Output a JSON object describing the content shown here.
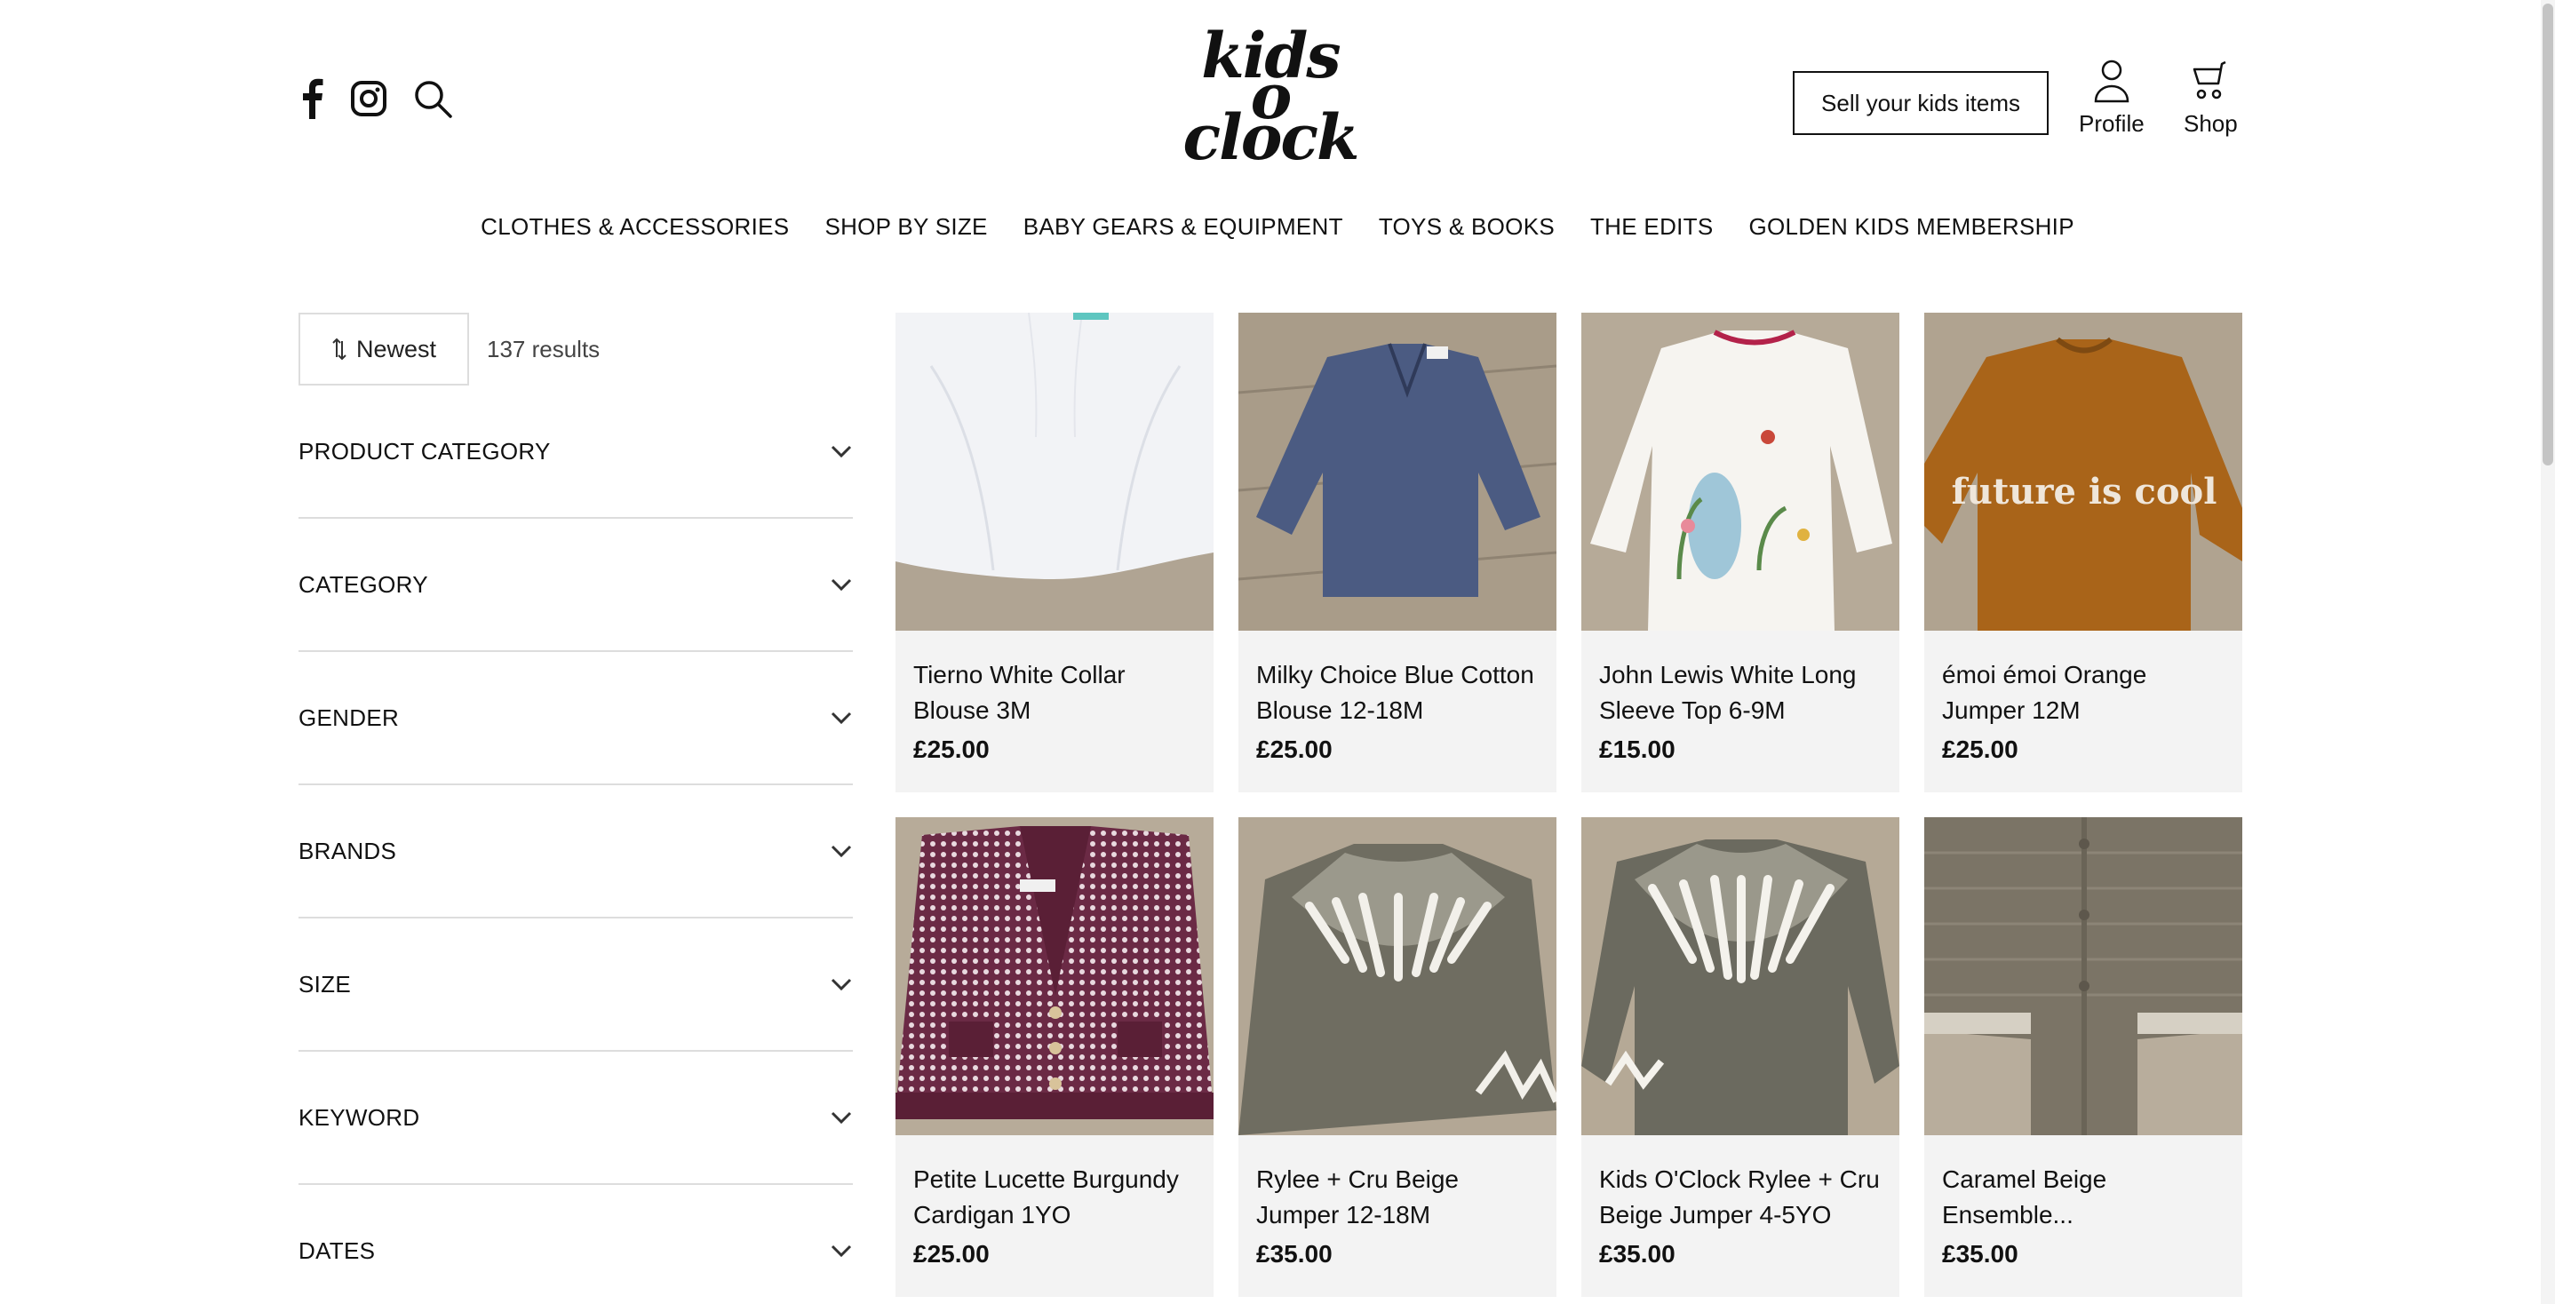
{
  "header": {
    "logo_lines": [
      "kids",
      "o",
      "clock"
    ],
    "sell_label": "Sell your kids items",
    "profile_label": "Profile",
    "shop_label": "Shop",
    "icons": [
      "facebook-icon",
      "instagram-icon",
      "search-icon",
      "profile-icon",
      "cart-icon"
    ]
  },
  "nav": [
    "CLOTHES & ACCESSORIES",
    "SHOP BY SIZE",
    "BABY GEARS & EQUIPMENT",
    "TOYS & BOOKS",
    "THE EDITS",
    "GOLDEN KIDS MEMBERSHIP"
  ],
  "sort": {
    "label": "Newest",
    "results": "137 results"
  },
  "filters": [
    "PRODUCT CATEGORY",
    "CATEGORY",
    "GENDER",
    "BRANDS",
    "SIZE",
    "KEYWORD",
    "DATES"
  ],
  "products": [
    {
      "name": "Tierno White Collar Blouse 3M",
      "price": "£25.00"
    },
    {
      "name": "Milky Choice Blue Cotton Blouse 12-18M",
      "price": "£25.00"
    },
    {
      "name": "John Lewis White Long Sleeve Top 6-9M",
      "price": "£15.00"
    },
    {
      "name": "émoi émoi Orange Jumper 12M",
      "price": "£25.00"
    },
    {
      "name": "Petite Lucette Burgundy Cardigan 1YO",
      "price": "£25.00"
    },
    {
      "name": "Rylee + Cru Beige Jumper 12-18M",
      "price": "£35.00"
    },
    {
      "name": "Kids O'Clock Rylee + Cru Beige Jumper 4-5YO",
      "price": "£35.00"
    },
    {
      "name": "Caramel Beige Ensemble...",
      "price": "£35.00"
    }
  ],
  "product_image_text": {
    "jumper_print": "future is cool"
  },
  "colors": {
    "text": "#111111",
    "divider": "#dddddd",
    "card_bg": "#f3f3f3"
  }
}
